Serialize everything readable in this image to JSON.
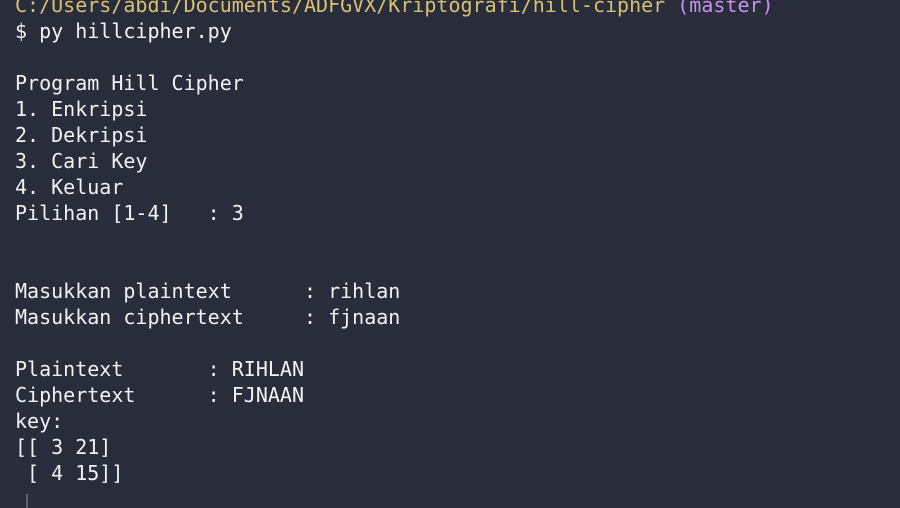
{
  "terminal": {
    "path_line": "C:/Users/abdi/Documents/ADFGVX/Kriptografi/hill-cipher",
    "branch": "(master)",
    "prompt": "$",
    "command": "py hillcipher.py",
    "lines": [
      "",
      "Program Hill Cipher",
      "1. Enkripsi",
      "2. Dekripsi",
      "3. Cari Key",
      "4. Keluar",
      "Pilihan [1-4]   : 3",
      "",
      "",
      "Masukkan plaintext      : rihlan",
      "Masukkan ciphertext     : fjnaan",
      "",
      "Plaintext       : RIHLAN",
      "Ciphertext      : FJNAAN",
      "key:",
      "[[ 3 21]",
      " [ 4 15]]"
    ]
  },
  "colors": {
    "background": "#282c3b",
    "text": "#f2f2f2",
    "path": "#d8c070",
    "branch": "#c792ea"
  }
}
